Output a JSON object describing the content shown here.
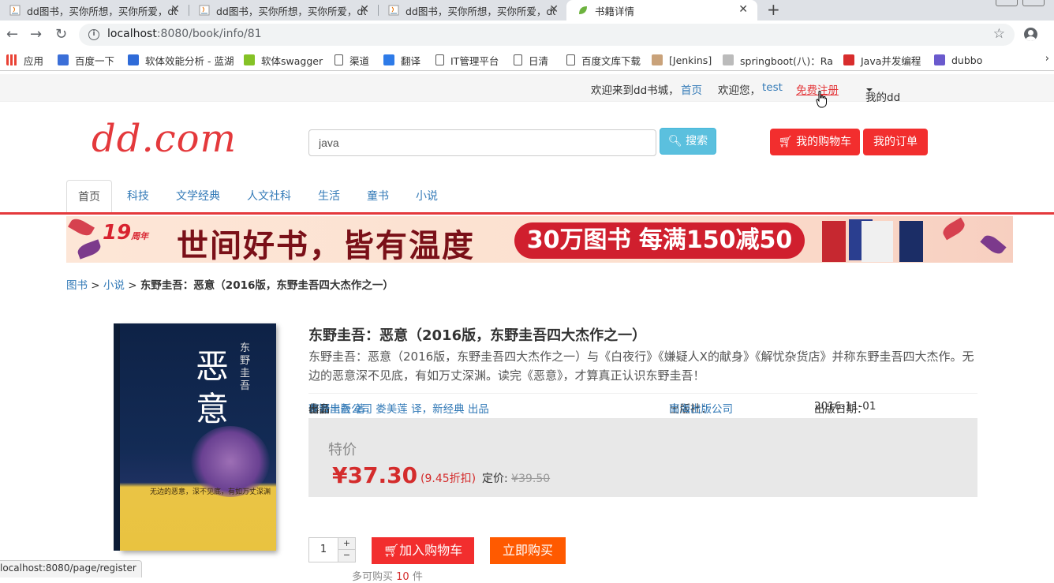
{
  "browser": {
    "tabs": [
      {
        "title": "dd图书，买你所想，买你所爱，dd图书",
        "active": false
      },
      {
        "title": "dd图书，买你所想，买你所爱，dd图书",
        "active": false
      },
      {
        "title": "dd图书，买你所想，买你所爱，dd图书",
        "active": false
      },
      {
        "title": "书籍详情",
        "active": true
      }
    ],
    "url_host": "localhost",
    "url_rest": ":8080/book/info/81",
    "bookmarks": [
      {
        "label": "应用",
        "icon": "apps-icon"
      },
      {
        "label": "百度一下",
        "icon": "baidu-icon"
      },
      {
        "label": "软体效能分析 - 蓝湖",
        "icon": "lanhu-icon"
      },
      {
        "label": "软体swagger",
        "icon": "swagger-icon"
      },
      {
        "label": "渠道",
        "icon": "page-icon"
      },
      {
        "label": "翻译",
        "icon": "translate-icon"
      },
      {
        "label": "IT管理平台",
        "icon": "page-icon"
      },
      {
        "label": "日清",
        "icon": "page-icon"
      },
      {
        "label": "百度文库下载",
        "icon": "page-icon"
      },
      {
        "label": "[Jenkins]",
        "icon": "jenkins-icon"
      },
      {
        "label": "springboot(八)：Ra",
        "icon": "globe-icon"
      },
      {
        "label": "Java并发编程",
        "icon": "csdn-icon"
      },
      {
        "label": "dubbo",
        "icon": "dubbo-icon"
      }
    ],
    "status_url": "localhost:8080/page/register"
  },
  "site": {
    "welcome": "欢迎来到dd书城，",
    "home_link": "首页",
    "greeting": "欢迎您，",
    "username": "test",
    "register": "免费注册",
    "my_dd": "我的dd",
    "logo": "dd.com",
    "search_value": "java",
    "search_button": "搜索",
    "cart_button": "我的购物车",
    "orders_button": "我的订单",
    "categories": [
      "首页",
      "科技",
      "文学经典",
      "人文社科",
      "生活",
      "童书",
      "小说"
    ],
    "banner": {
      "badge": "19",
      "badge_suffix": "周年",
      "slogan": "世间好书，皆有温度",
      "promo": "30万图书 每满150减50"
    }
  },
  "breadcrumb": {
    "root": "图书",
    "sep1": " > ",
    "category": "小说",
    "sep2": " > ",
    "current": "东野圭吾：恶意（2016版，东野圭吾四大杰作之一）"
  },
  "book": {
    "cover_title": "恶意",
    "cover_author": "东野圭吾",
    "cover_tagline": "无边的恶意，深不见底，有如万丈深渊",
    "title": "东野圭吾：恶意（2016版，东野圭吾四大杰作之一）",
    "description": "东野圭吾：恶意（2016版，东野圭吾四大杰作之一）与《白夜行》《嫌疑人X的献身》《解忧杂货店》并称东野圭吾四大杰作。无边的恶意深不见底，有如万丈深渊。读完《恶意》，才算真正认识东野圭吾！",
    "author_label": "作者",
    "author": "东野圭吾 著，娄美莲 译，新经典 出品",
    "author_suffix": "著，",
    "publisher_inline": "南海出版公司",
    "publisher_inline_suffix": " 出品",
    "publisher_label": "出版社：",
    "publisher": "南海出版公司",
    "pubdate_label": "出版日期：",
    "pubdate": "2016-11-01",
    "price_label": "特价",
    "price": "¥37.30",
    "discount": "(9.45折扣)",
    "list_price_label": "定价:",
    "list_price": "¥39.50",
    "quantity": "1",
    "add_to_cart": "加入购物车",
    "buy_now": "立即购买",
    "limit_prefix": "多可购买",
    "limit_count": "10",
    "limit_suffix": "件"
  }
}
